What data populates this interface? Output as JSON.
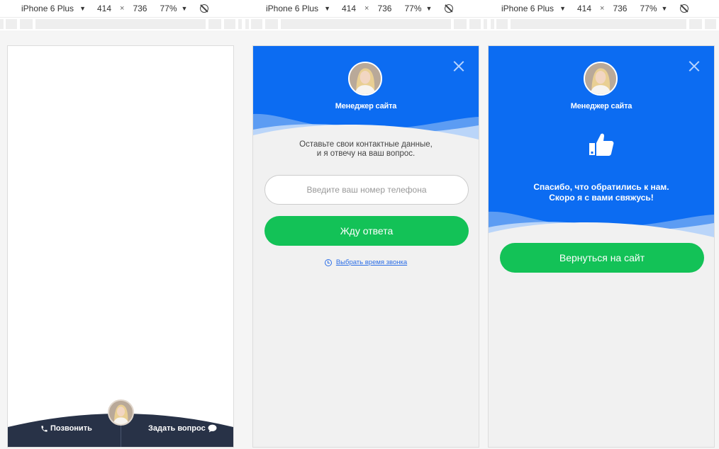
{
  "toolbars": [
    {
      "device": "iPhone 6 Plus",
      "width": "414",
      "x": "×",
      "height": "736",
      "zoom": "77%"
    },
    {
      "device": "iPhone 6 Plus",
      "width": "414",
      "x": "×",
      "height": "736",
      "zoom": "77%"
    },
    {
      "device": "iPhone 6 Plus",
      "width": "414",
      "x": "×",
      "height": "736",
      "zoom": "77%"
    }
  ],
  "screen1": {
    "call_label": "Позвонить",
    "ask_label": "Задать вопрос"
  },
  "screen2": {
    "manager_title": "Менеджер сайта",
    "prompt_line1": "Оставьте свои контактные данные,",
    "prompt_line2": "и я отвечу на ваш вопрос.",
    "phone_value": "",
    "phone_placeholder": "Введите ваш номер телефона",
    "submit_label": "Жду ответа",
    "time_link": "Выбрать время звонка"
  },
  "screen3": {
    "manager_title": "Менеджер сайта",
    "thanks_line1": "Спасибо, что обратились к нам.",
    "thanks_line2": "Скоро я с вами свяжусь!",
    "back_label": "Вернуться на сайт"
  },
  "colors": {
    "blue": "#0c6cf2",
    "green": "#13c257",
    "dark_bar": "#283247"
  },
  "icons": [
    "chevron-down-icon",
    "rotate-icon",
    "phone-icon",
    "chat-icon",
    "close-icon",
    "clock-icon",
    "thumbs-up-icon"
  ]
}
